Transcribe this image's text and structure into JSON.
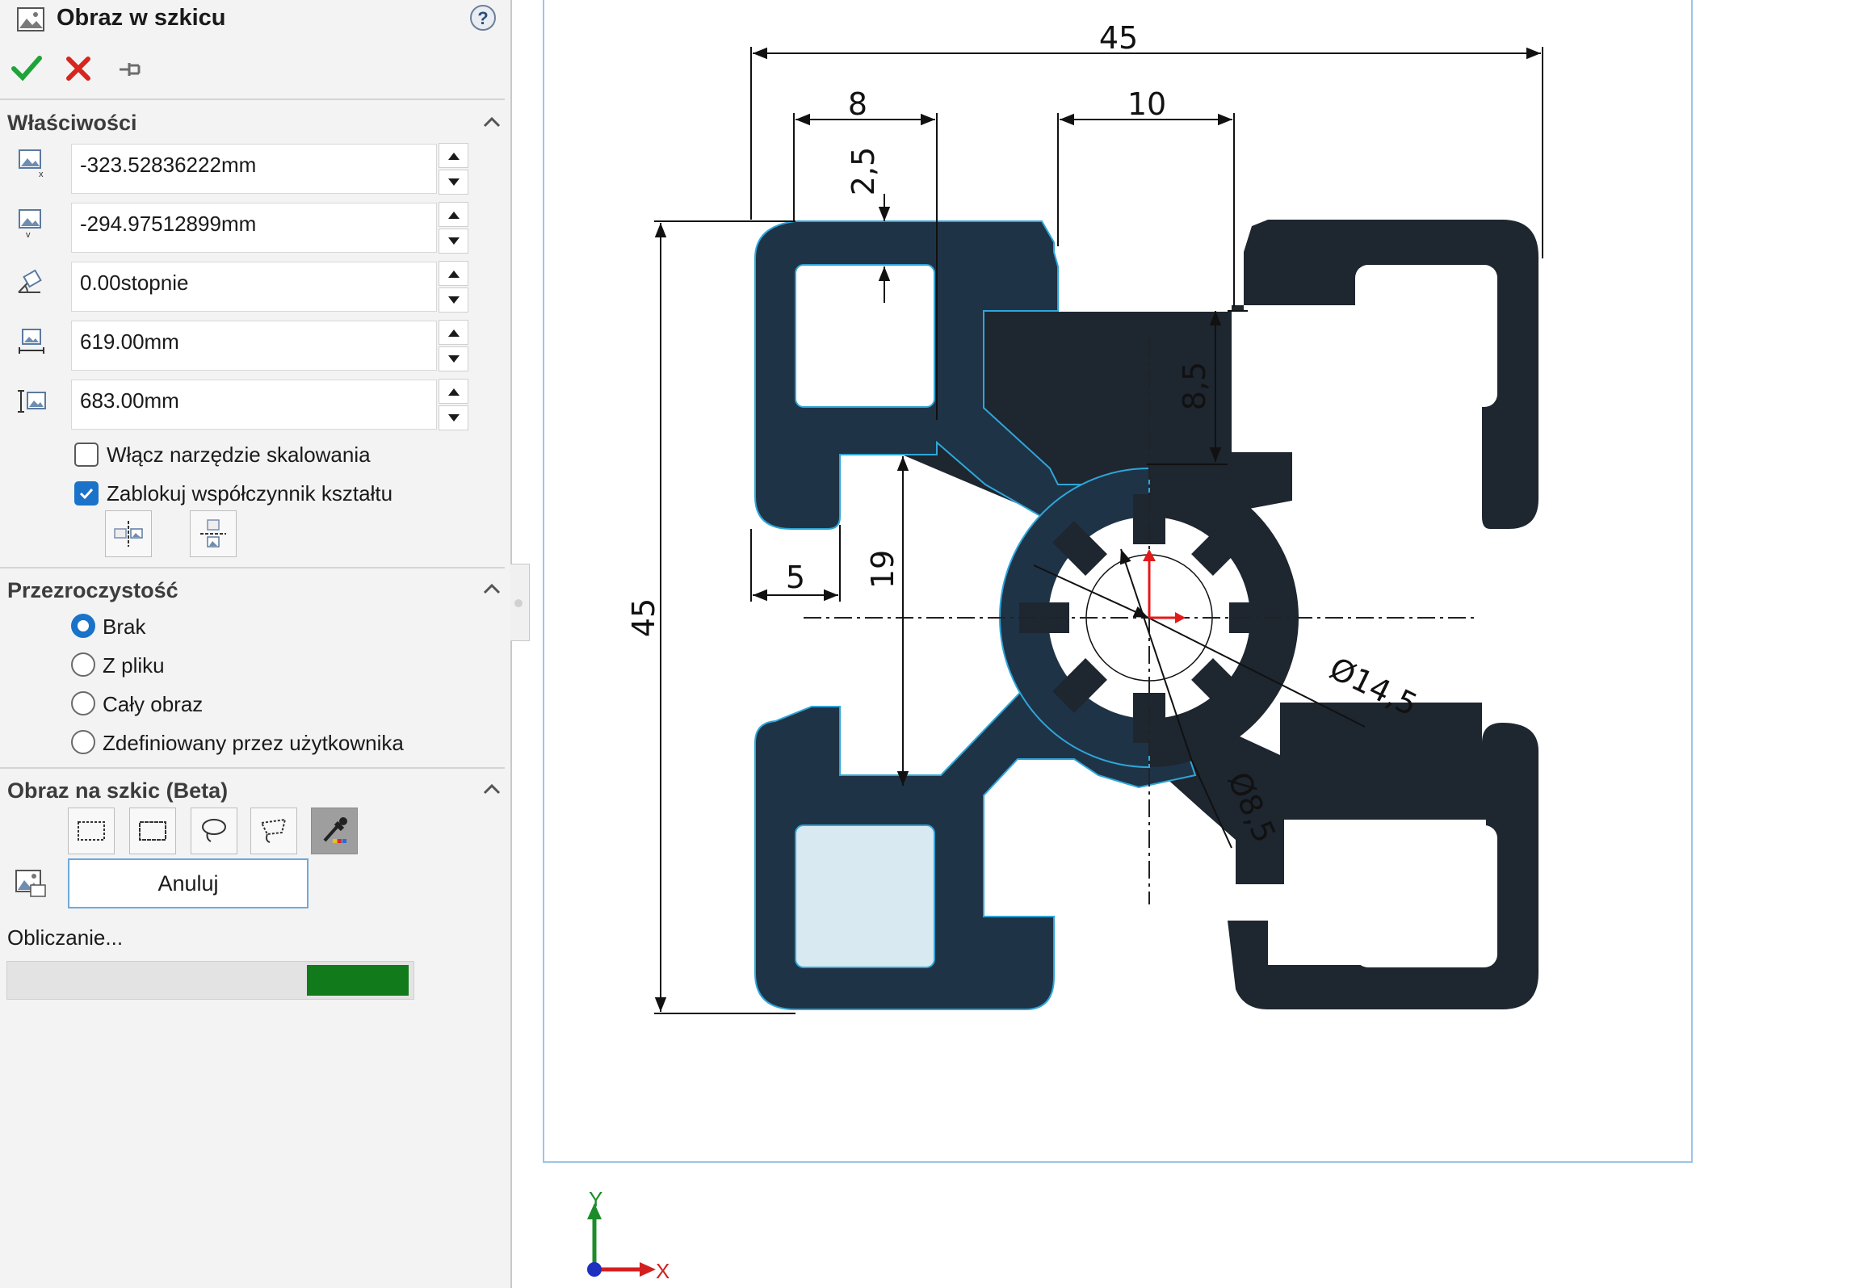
{
  "panel": {
    "title": "Obraz w szkicu",
    "help_icon": "help-icon",
    "accent_color": "#1a73c9",
    "properties": {
      "title": "Właściwości",
      "fields": [
        {
          "name": "x-position",
          "value": "-323.52836222mm"
        },
        {
          "name": "y-position",
          "value": "-294.97512899mm"
        },
        {
          "name": "angle",
          "value": "0.00stopnie"
        },
        {
          "name": "width",
          "value": "619.00mm"
        },
        {
          "name": "height",
          "value": "683.00mm"
        }
      ],
      "enable_scaling_label": "Włącz narzędzie skalowania",
      "enable_scaling_checked": false,
      "lock_aspect_label": "Zablokuj współczynnik kształtu",
      "lock_aspect_checked": true
    },
    "transparency": {
      "title": "Przezroczystość",
      "options": [
        "Brak",
        "Z pliku",
        "Cały obraz",
        "Zdefiniowany przez użytkownika"
      ],
      "selected": "Brak"
    },
    "sketch_image": {
      "title": "Obraz na szkic (Beta)",
      "cancel_label": "Anuluj",
      "status": "Obliczanie...",
      "progress": 0.25,
      "progress_color": "#117a1b"
    }
  },
  "drawing": {
    "dimensions": [
      "45",
      "8",
      "10",
      "2,5",
      "8,5",
      "5",
      "19",
      "45",
      "Ø14,5",
      "Ø8,5"
    ],
    "profile_color": "#1e2630",
    "selected_color": "#1f3347",
    "hole_fill": "#d8e9f2",
    "outline_color": "#2ea6d8"
  },
  "axes": {
    "x": "X",
    "y": "Y"
  }
}
